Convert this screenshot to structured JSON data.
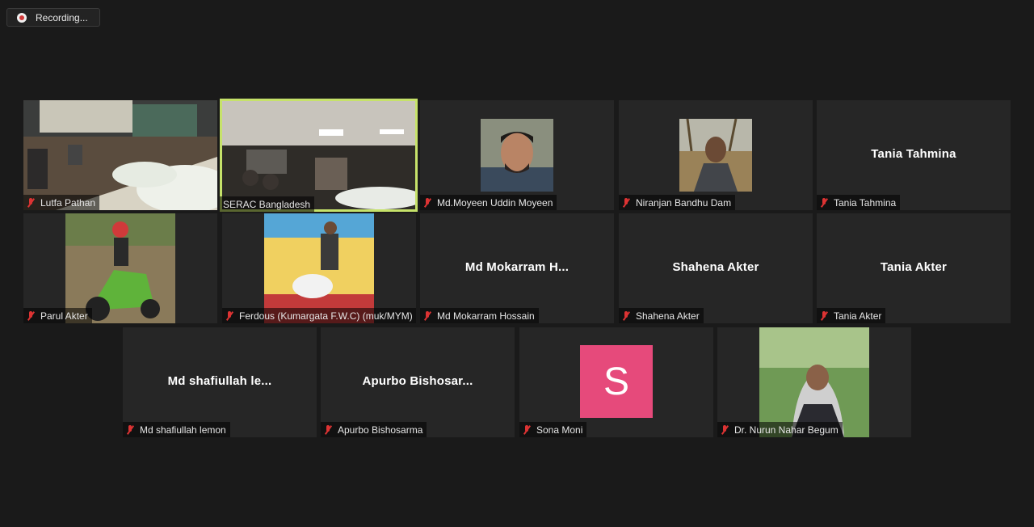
{
  "recording": {
    "label": "Recording..."
  },
  "participants": [
    {
      "name": "Lutfa Pathan"
    },
    {
      "name": "SERAC Bangladesh"
    },
    {
      "name": "Md.Moyeen Uddin Moyeen"
    },
    {
      "name": "Niranjan Bandhu Dam"
    },
    {
      "name": "Tania Tahmina",
      "display": "Tania Tahmina"
    },
    {
      "name": "Parul Akter"
    },
    {
      "name": "Ferdous (Kumargata F.W.C) (muk/MYM)"
    },
    {
      "name": "Md Mokarram Hossain",
      "display": "Md Mokarram H..."
    },
    {
      "name": "Shahena Akter",
      "display": "Shahena Akter"
    },
    {
      "name": "Tania Akter",
      "display": "Tania Akter"
    },
    {
      "name": "Md shafiullah lemon",
      "display": "Md shafiullah le..."
    },
    {
      "name": "Apurbo Bishosarma",
      "display": "Apurbo Bishosar..."
    },
    {
      "name": "Sona Moni",
      "initial": "S"
    },
    {
      "name": "Dr. Nurun Nahar Begum"
    }
  ],
  "colors": {
    "active_speaker": "#c6e26a",
    "avatar_bg": "#e64a7b",
    "muted_icon": "#dd3333"
  }
}
